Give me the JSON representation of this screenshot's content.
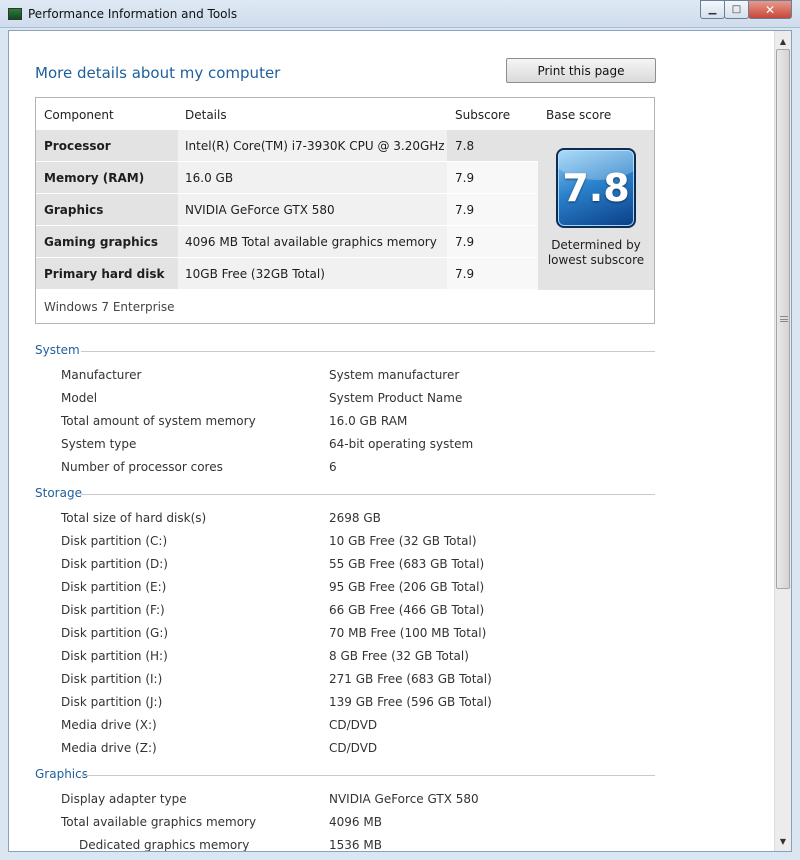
{
  "window": {
    "title": "Performance Information and Tools",
    "minimize_glyph": "▁",
    "maximize_glyph": "□",
    "close_glyph": "✕"
  },
  "header": {
    "heading": "More details about my computer",
    "print_button": "Print this page"
  },
  "score_table": {
    "columns": [
      "Component",
      "Details",
      "Subscore",
      "Base score"
    ],
    "rows": [
      {
        "component": "Processor",
        "details": "Intel(R) Core(TM) i7-3930K CPU @ 3.20GHz",
        "subscore": "7.8"
      },
      {
        "component": "Memory (RAM)",
        "details": "16.0 GB",
        "subscore": "7.9"
      },
      {
        "component": "Graphics",
        "details": "NVIDIA GeForce GTX 580",
        "subscore": "7.9"
      },
      {
        "component": "Gaming graphics",
        "details": "4096 MB Total available graphics memory",
        "subscore": "7.9"
      },
      {
        "component": "Primary hard disk",
        "details": "10GB Free (32GB Total)",
        "subscore": "7.9"
      }
    ],
    "base_score": "7.8",
    "base_caption_1": "Determined by",
    "base_caption_2": "lowest subscore",
    "os": "Windows 7 Enterprise"
  },
  "sections": {
    "system": {
      "title": "System",
      "items": [
        {
          "label": "Manufacturer",
          "value": "System manufacturer"
        },
        {
          "label": "Model",
          "value": "System Product Name"
        },
        {
          "label": "Total amount of system memory",
          "value": "16.0 GB RAM"
        },
        {
          "label": "System type",
          "value": "64-bit operating system"
        },
        {
          "label": "Number of processor cores",
          "value": "6"
        }
      ]
    },
    "storage": {
      "title": "Storage",
      "items": [
        {
          "label": "Total size of hard disk(s)",
          "value": "2698 GB"
        },
        {
          "label": "Disk partition (C:)",
          "value": "10 GB Free (32 GB Total)"
        },
        {
          "label": "Disk partition (D:)",
          "value": "55 GB Free (683 GB Total)"
        },
        {
          "label": "Disk partition (E:)",
          "value": "95 GB Free (206 GB Total)"
        },
        {
          "label": "Disk partition (F:)",
          "value": "66 GB Free (466 GB Total)"
        },
        {
          "label": "Disk partition (G:)",
          "value": "70 MB Free (100 MB Total)"
        },
        {
          "label": "Disk partition (H:)",
          "value": "8 GB Free (32 GB Total)"
        },
        {
          "label": "Disk partition (I:)",
          "value": "271 GB Free (683 GB Total)"
        },
        {
          "label": "Disk partition (J:)",
          "value": "139 GB Free (596 GB Total)"
        },
        {
          "label": "Media drive (X:)",
          "value": "CD/DVD"
        },
        {
          "label": "Media drive (Z:)",
          "value": "CD/DVD"
        }
      ]
    },
    "graphics": {
      "title": "Graphics",
      "items": [
        {
          "label": "Display adapter type",
          "value": "NVIDIA GeForce GTX 580"
        },
        {
          "label": "Total available graphics memory",
          "value": "4096 MB"
        },
        {
          "label": "Dedicated graphics memory",
          "value": "1536 MB"
        }
      ]
    }
  }
}
